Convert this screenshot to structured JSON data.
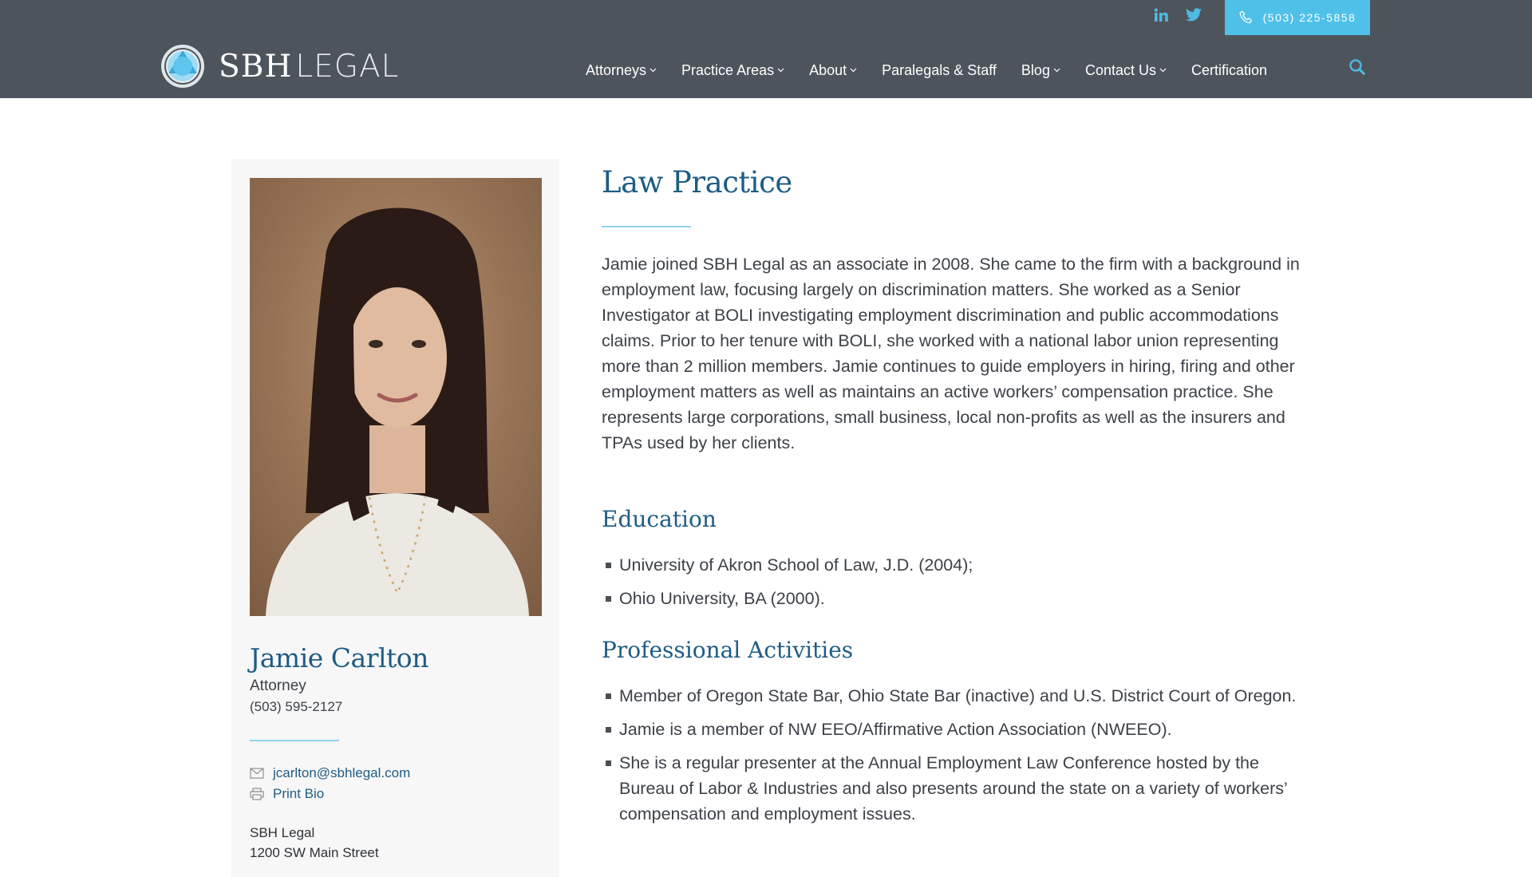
{
  "header": {
    "logo_text_main": "SBH",
    "logo_text_light": "LEGAL",
    "social": [
      "linkedin-icon",
      "twitter-icon"
    ],
    "phone": "(503) 225-5858",
    "nav": [
      {
        "label": "Attorneys",
        "dropdown": true
      },
      {
        "label": "Practice Areas",
        "dropdown": true
      },
      {
        "label": "About",
        "dropdown": true
      },
      {
        "label": "Paralegals & Staff",
        "dropdown": false
      },
      {
        "label": "Blog",
        "dropdown": true
      },
      {
        "label": "Contact Us",
        "dropdown": true
      },
      {
        "label": "Certification",
        "dropdown": false
      }
    ]
  },
  "sidebar": {
    "name": "Jamie Carlton",
    "title": "Attorney",
    "phone": "(503) 595-2127",
    "email": "jcarlton@sbhlegal.com",
    "print_label": "Print Bio",
    "office_name": "SBH Legal",
    "office_address": "1200 SW Main Street"
  },
  "main": {
    "heading": "Law Practice",
    "bio": "Jamie joined SBH Legal as an associate in 2008. She came to the firm with a background in employment law, focusing largely on discrimination matters. She worked as a Senior Investigator at BOLI investigating employment discrimination and public accommodations claims. Prior to her tenure with BOLI, she worked with a national labor union representing more than 2 million members. Jamie continues to guide employers in hiring, firing and other employment matters as well as maintains an active workers’ compensation practice. She represents large corporations, small business, local non-profits as well as the insurers and TPAs used by her clients.",
    "education_heading": "Education",
    "education": [
      "University of Akron School of Law, J.D. (2004);",
      "Ohio University, BA (2000)."
    ],
    "activities_heading": "Professional Activities",
    "activities": [
      "Member of Oregon State Bar, Ohio State Bar (inactive) and U.S. District Court of Oregon.",
      "Jamie is a member of NW EEO/Affirmative Action Association (NWEEO).",
      "She is a regular presenter at the Annual Employment Law Conference hosted by the Bureau of Labor & Industries and also presents around the state on a variety of workers’ compensation and employment issues."
    ]
  },
  "colors": {
    "header_bg": "#4e545b",
    "accent_blue": "#4fc1e9",
    "heading_blue": "#1e5c84",
    "sidebar_bg": "#f7f7f7"
  }
}
